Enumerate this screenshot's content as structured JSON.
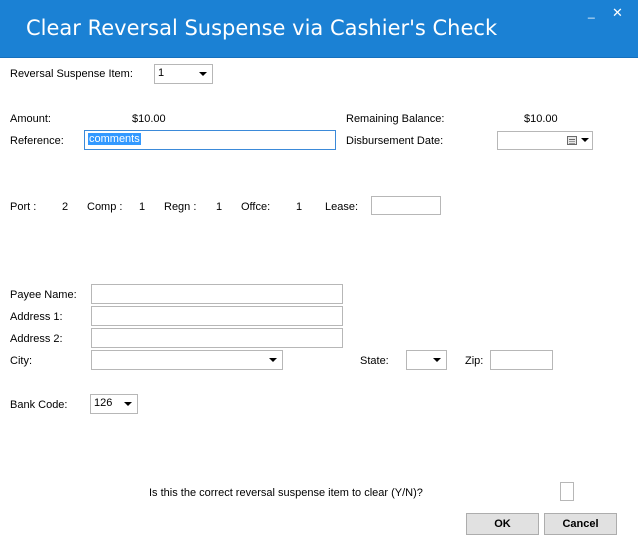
{
  "window": {
    "title": "Clear Reversal Suspense via Cashier's Check",
    "minimize_glyph": "_",
    "close_glyph": "✕"
  },
  "reversal_item": {
    "label": "Reversal  Suspense Item:",
    "value": "1"
  },
  "amount": {
    "label": "Amount:",
    "value": "$10.00"
  },
  "remaining_balance": {
    "label": "Remaining Balance:",
    "value": "$10.00"
  },
  "reference": {
    "label": "Reference:",
    "value": "comments"
  },
  "disbursement_date": {
    "label": "Disbursement Date:",
    "value": ""
  },
  "location": {
    "port_label": "Port :",
    "port_value": "2",
    "comp_label": "Comp :",
    "comp_value": "1",
    "regn_label": "Regn :",
    "regn_value": "1",
    "offce_label": "Offce:",
    "offce_value": "1",
    "lease_label": "Lease:",
    "lease_value": ""
  },
  "payee": {
    "name_label": "Payee Name:",
    "name_value": "",
    "address1_label": "Address 1:",
    "address1_value": "",
    "address2_label": "Address 2:",
    "address2_value": "",
    "city_label": "City:",
    "city_value": "",
    "state_label": "State:",
    "state_value": "",
    "zip_label": "Zip:",
    "zip_value": ""
  },
  "bank": {
    "label": "Bank Code:",
    "value": "126"
  },
  "confirm": {
    "question": "Is this the correct reversal suspense item to clear (Y/N)?",
    "value": ""
  },
  "buttons": {
    "ok": "OK",
    "cancel": "Cancel"
  }
}
